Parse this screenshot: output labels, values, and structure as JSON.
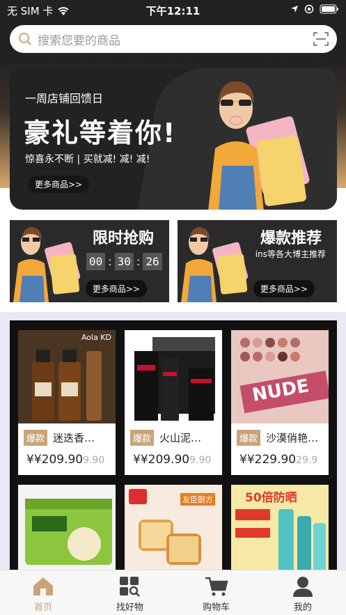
{
  "status_bar": {
    "carrier": "无 SIM 卡",
    "time": "下午12:11"
  },
  "search": {
    "placeholder": "搜索您要的商品"
  },
  "hero": {
    "subtitle": "一周店铺回馈日",
    "title": "豪礼等着你!",
    "tagline": "惊喜永不断 | 买就减! 减! 减!",
    "more": "更多商品>>"
  },
  "promos": [
    {
      "title": "限时抢购",
      "timer": [
        "00",
        "30",
        "26"
      ],
      "more": "更多商品>>"
    },
    {
      "title": "爆款推荐",
      "sub": "ins等各大博主推荐",
      "more": "更多商品>>"
    }
  ],
  "products": [
    {
      "tag": "爆款",
      "name": "迷迭香…",
      "price": "¥209.90",
      "old": "9.90"
    },
    {
      "tag": "爆款",
      "name": "火山泥…",
      "price": "¥209.90",
      "old": "9.90"
    },
    {
      "tag": "爆款",
      "name": "沙漠俏艳…",
      "price": "¥229.90",
      "old": "29.9"
    }
  ],
  "product_images": {
    "brand1": "Aola KD",
    "nude": "NUDE",
    "sunscreen": "50倍防晒",
    "bread": "友臣厨方"
  },
  "price_prefix": "¥",
  "tabs": [
    {
      "label": "首页",
      "icon": "home-icon"
    },
    {
      "label": "找好物",
      "icon": "discover-icon"
    },
    {
      "label": "购物车",
      "icon": "cart-icon"
    },
    {
      "label": "我的",
      "icon": "profile-icon"
    }
  ],
  "colors": {
    "accent": "#c9a47a",
    "dark": "#222222"
  }
}
